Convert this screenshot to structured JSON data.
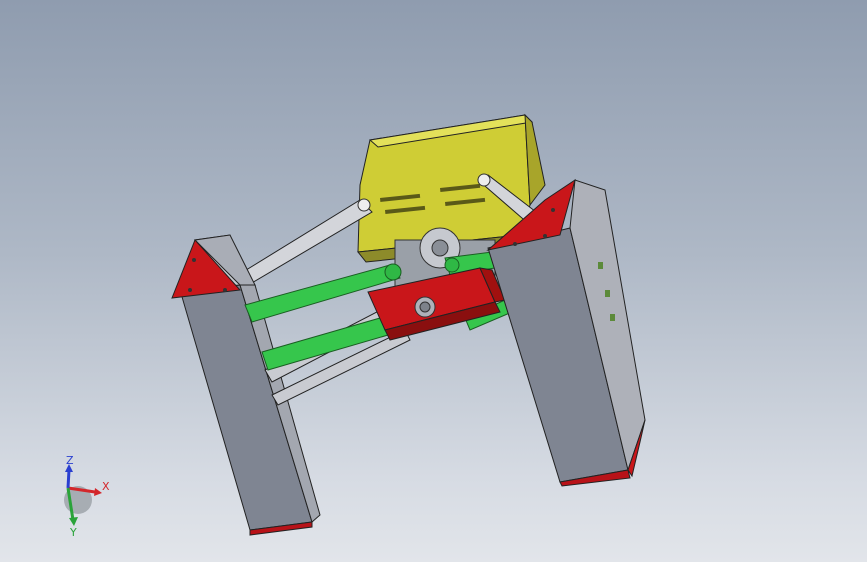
{
  "viewport": {
    "background_top": "#8f9caf",
    "background_bottom": "#e2e5ea"
  },
  "model": {
    "colors": {
      "frame": "#b9bcc4",
      "frame_dark": "#6f7480",
      "box": "#d6d43a",
      "box_side": "#a7a72a",
      "link_green": "#33c24a",
      "link_green_dark": "#1f8a2c",
      "link_grey": "#cfd1d6",
      "block_red": "#c9161a",
      "foot_red": "#b81218",
      "pin": "#9aa0a8"
    }
  },
  "triad": {
    "x_label": "X",
    "y_label": "Y",
    "z_label": "Z",
    "colors": {
      "x": "#d3262b",
      "y": "#2aa33a",
      "z": "#2a3fd0",
      "sphere": "#9aa0a6"
    }
  }
}
